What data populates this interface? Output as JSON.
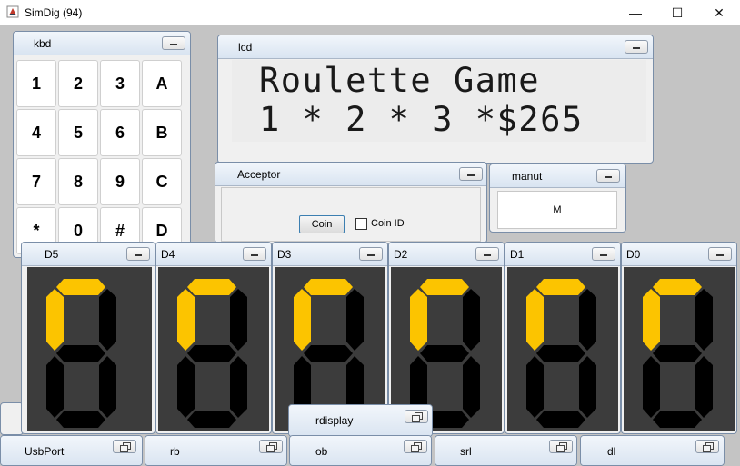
{
  "window": {
    "title": "SimDig (94)",
    "minimize_glyph": "—",
    "maximize_glyph": "☐",
    "close_glyph": "✕"
  },
  "colors": {
    "segment_on": "#fcc400",
    "segment_off": "#000000",
    "display_bg": "#3c3c3c"
  },
  "kbd": {
    "title": "kbd",
    "keys": [
      "1",
      "2",
      "3",
      "A",
      "4",
      "5",
      "6",
      "B",
      "7",
      "8",
      "9",
      "C",
      "*",
      "0",
      "#",
      "D"
    ]
  },
  "lcd": {
    "title": "lcd",
    "lines": [
      "Roulette Game",
      "1 * 2 * 3 *$265"
    ]
  },
  "acceptor": {
    "title": "Acceptor",
    "coin_button": "Coin",
    "coin_id_label": "Coin ID",
    "coin_id_checked": false
  },
  "manut": {
    "title": "manut",
    "value": "M"
  },
  "displays": [
    {
      "title": "D5",
      "lit": [
        "f",
        "a"
      ]
    },
    {
      "title": "D4",
      "lit": [
        "f",
        "a"
      ]
    },
    {
      "title": "D3",
      "lit": [
        "f",
        "a"
      ]
    },
    {
      "title": "D2",
      "lit": [
        "f",
        "a"
      ]
    },
    {
      "title": "D1",
      "lit": [
        "f",
        "a"
      ]
    },
    {
      "title": "D0",
      "lit": [
        "f",
        "a"
      ]
    }
  ],
  "rdisplay": {
    "title": "rdisplay"
  },
  "bottom_bars": [
    {
      "title": "UsbPort"
    },
    {
      "title": "rb"
    },
    {
      "title": "ob"
    },
    {
      "title": "srl"
    },
    {
      "title": "dl"
    }
  ]
}
